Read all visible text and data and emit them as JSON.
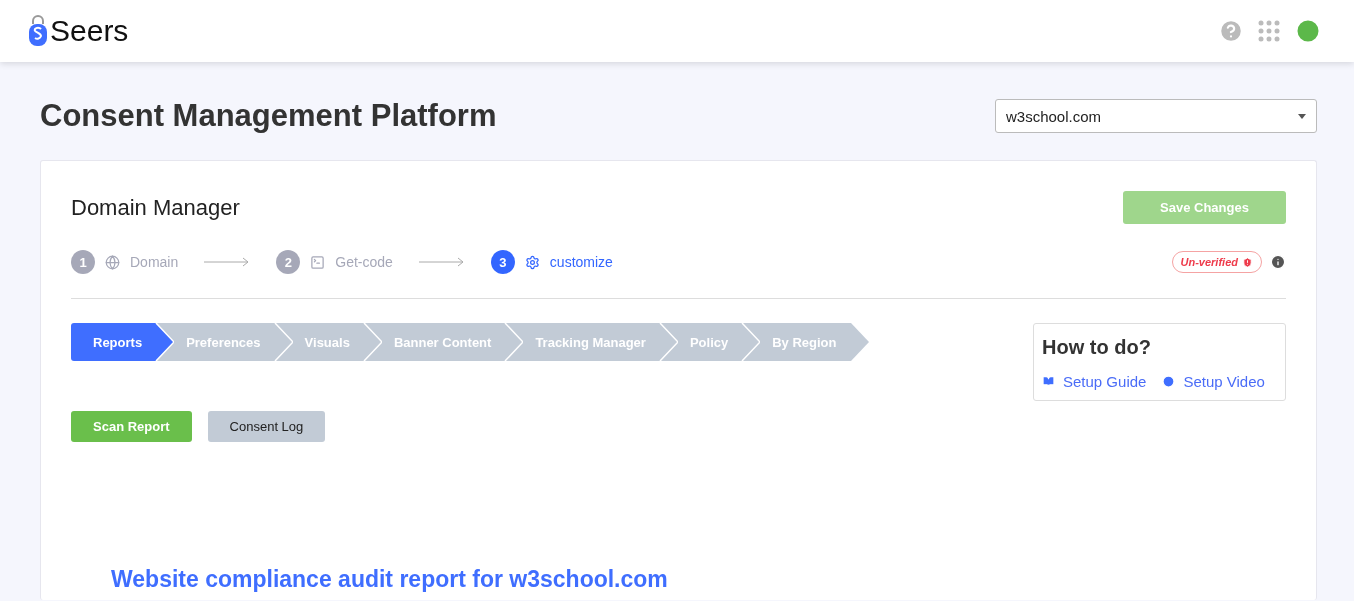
{
  "header": {
    "logo": "Seers"
  },
  "page_title": "Consent Management Platform",
  "domain_select": {
    "value": "w3school.com"
  },
  "card": {
    "title": "Domain Manager",
    "save_button": {
      "label": "Save Changes",
      "disabled": true
    },
    "steps": [
      {
        "number": "1",
        "label": "Domain",
        "selected": false
      },
      {
        "number": "2",
        "label": "Get-code",
        "selected": false
      },
      {
        "number": "3",
        "label": "customize",
        "selected": true
      }
    ],
    "status_badge": "Un-verified",
    "tabs": [
      {
        "label": "Reports",
        "selected": true
      },
      {
        "label": "Preferences",
        "selected": false
      },
      {
        "label": "Visuals",
        "selected": false
      },
      {
        "label": "Banner Content",
        "selected": false
      },
      {
        "label": "Tracking Manager",
        "selected": false
      },
      {
        "label": "Policy",
        "selected": false
      },
      {
        "label": "By Region",
        "selected": false
      }
    ],
    "sub_buttons": [
      {
        "label": "Scan Report",
        "selected": true
      },
      {
        "label": "Consent Log",
        "selected": false
      }
    ],
    "help": {
      "title": "How to do?",
      "links": [
        "Setup Guide",
        "Setup Video"
      ]
    },
    "report_heading": "Website compliance audit report for w3school.com"
  }
}
